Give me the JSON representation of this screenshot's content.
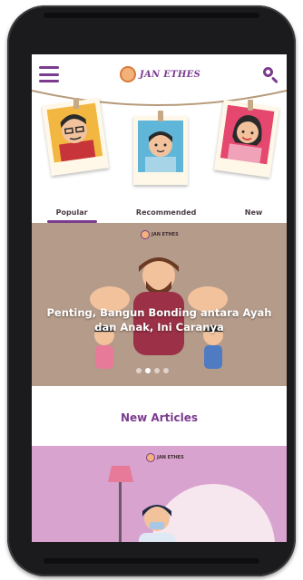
{
  "app": {
    "logo_text": "JAN ETHES",
    "menu_icon": "hamburger-menu-icon",
    "search_icon": "search-icon"
  },
  "tabs": [
    {
      "label": "Popular",
      "active": true
    },
    {
      "label": "Recommended",
      "active": false
    },
    {
      "label": "New",
      "active": false
    }
  ],
  "banner": {
    "brand": "JAN ETHES",
    "headline": "Penting, Bangun Bonding antara Ayah dan Anak, Ini Caranya",
    "slides_total": 4,
    "slide_active": 2
  },
  "articles": {
    "section_title": "New Articles",
    "card_brand": "JAN ETHES"
  },
  "colors": {
    "accent": "#7b3b8f",
    "banner_bg": "#b59b8a",
    "card_bg": "#d9a3cf"
  }
}
